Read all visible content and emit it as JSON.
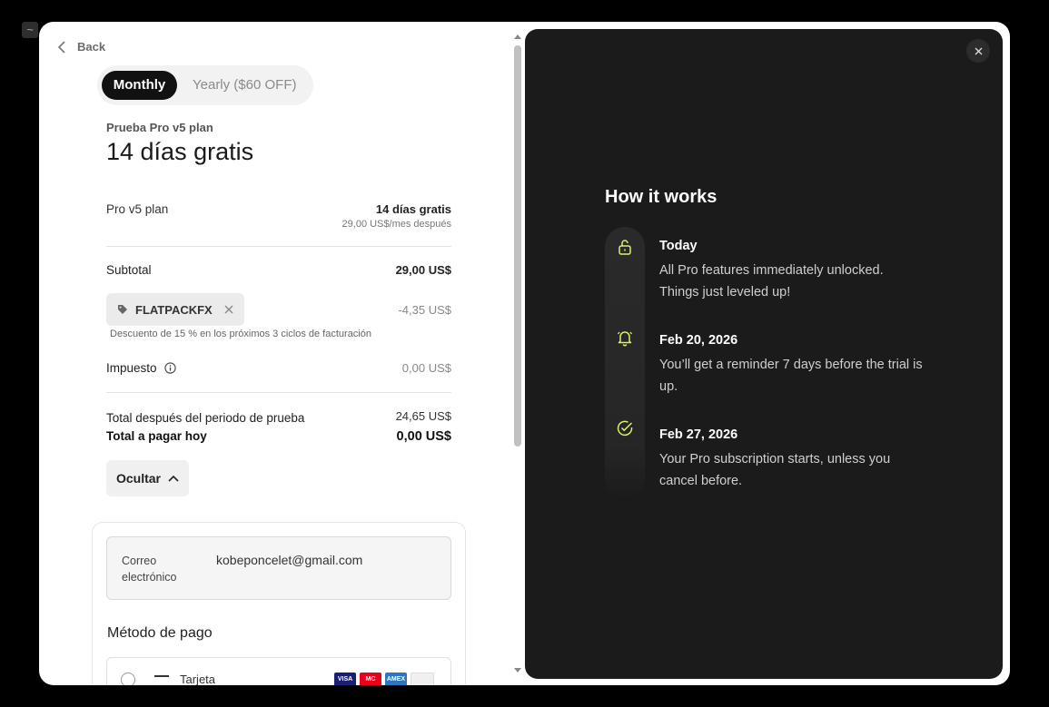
{
  "app_icon": "~",
  "back_label": "Back",
  "billing_toggle": {
    "monthly": "Monthly",
    "yearly": "Yearly ($60 OFF)"
  },
  "plan": {
    "subtitle": "Prueba Pro v5 plan",
    "title": "14 días gratis"
  },
  "summary": {
    "plan_name": "Pro v5 plan",
    "plan_price": "14 días gratis",
    "plan_after": "29,00 US$/mes después",
    "subtotal_label": "Subtotal",
    "subtotal_value": "29,00 US$",
    "coupon_code": "FLATPACKFX",
    "coupon_amount": "-4,35 US$",
    "coupon_note": "Descuento de 15 % en los próximos 3 ciclos de facturación",
    "tax_label": "Impuesto",
    "tax_value": "0,00 US$",
    "after_trial_label": "Total después del periodo de prueba",
    "after_trial_value": "24,65 US$",
    "due_today_label": "Total a pagar hoy",
    "due_today_value": "0,00 US$",
    "hide_label": "Ocultar"
  },
  "contact": {
    "email_label": "Correo electrónico",
    "email_value": "kobeponcelet@gmail.com"
  },
  "payment": {
    "title": "Método de pago",
    "option_label": "Tarjeta",
    "brands": [
      {
        "name": "visa",
        "text": "VISA",
        "color": "#1a1f71"
      },
      {
        "name": "mastercard",
        "text": "MC",
        "color": "#eb001b"
      },
      {
        "name": "amex",
        "text": "AMEX",
        "color": "#2e77bc"
      },
      {
        "name": "discover",
        "text": "",
        "color": "#f0f0f0"
      }
    ]
  },
  "how_it_works": {
    "title": "How it works",
    "accent_color": "#d6f26b",
    "steps": [
      {
        "icon": "unlock-icon",
        "title": "Today",
        "text": "All Pro features immediately unlocked. Things just leveled up!"
      },
      {
        "icon": "bell-icon",
        "title": "Feb 20, 2026",
        "text": "You’ll get a reminder 7 days before the trial is up."
      },
      {
        "icon": "check-circle-icon",
        "title": "Feb 27, 2026",
        "text": "Your Pro subscription starts, unless you cancel before."
      }
    ]
  }
}
